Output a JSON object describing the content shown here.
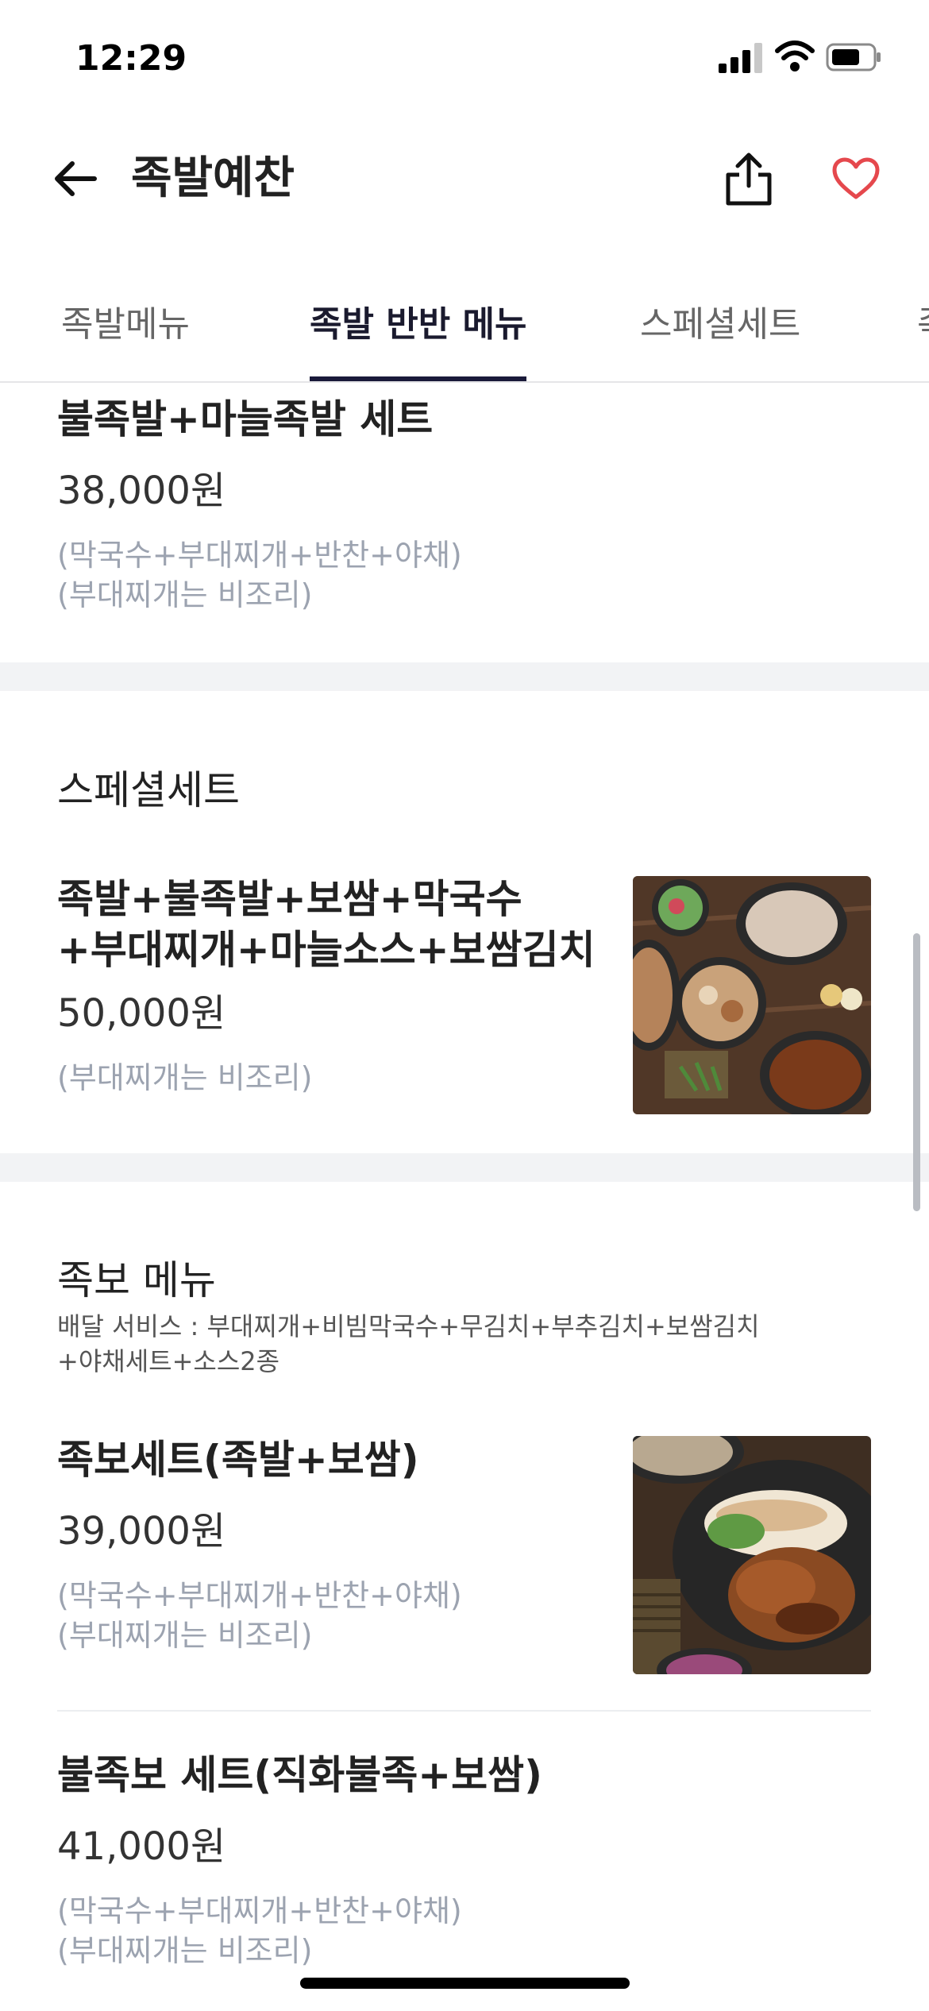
{
  "status_bar": {
    "time": "12:29"
  },
  "header": {
    "title": "족발예찬"
  },
  "tabs": [
    "족발메뉴",
    "족발 반반 메뉴",
    "스페셜세트",
    "족"
  ],
  "items_top": [
    {
      "name": "불족발+마늘족발 세트",
      "price": "38,000원",
      "desc1": "(막국수+부대찌개+반찬+야채)",
      "desc2": "(부대찌개는 비조리)"
    }
  ],
  "special": {
    "title": "스페셜세트",
    "item": {
      "name1": "족발+불족발+보쌈+막국수",
      "name2": "+부대찌개+마늘소스+보쌈김치",
      "price": "50,000원",
      "desc1": "(부대찌개는 비조리)"
    }
  },
  "jokbo": {
    "title": "족보 메뉴",
    "sub1": "배달 서비스 : 부대찌개+비빔막국수+무김치+부추김치+보쌈김치",
    "sub2": "+야채세트+소스2종",
    "items": [
      {
        "name": "족보세트(족발+보쌈)",
        "price": "39,000원",
        "desc1": "(막국수+부대찌개+반찬+야채)",
        "desc2": "(부대찌개는 비조리)"
      },
      {
        "name": "불족보 세트(직화불족+보쌈)",
        "price": "41,000원",
        "desc1": "(막국수+부대찌개+반찬+야채)",
        "desc2": "(부대찌개는 비조리)"
      }
    ]
  },
  "colors": {
    "accent": "#e5484d",
    "tab_underline": "#1a1a3a",
    "muted": "#9ca3b0"
  },
  "icons": [
    "back-arrow-icon",
    "share-icon",
    "heart-icon",
    "signal-icon",
    "wifi-icon",
    "battery-icon"
  ]
}
